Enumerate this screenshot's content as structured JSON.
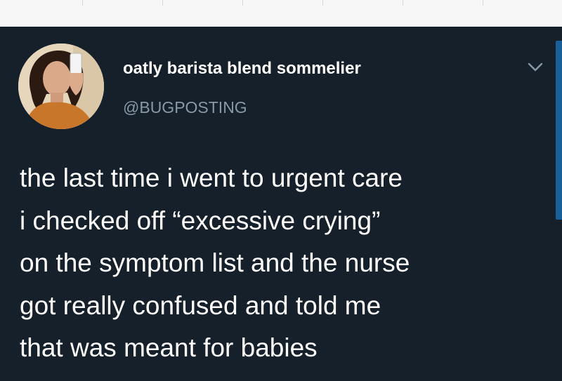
{
  "tweet": {
    "author": {
      "display_name": "oatly barista blend sommelier",
      "handle": "@BUGPOSTING",
      "avatar_icon": "profile-photo"
    },
    "menu_icon": "chevron-down-icon",
    "text_lines": [
      "the last time i went to urgent care",
      "i checked off “excessive crying”",
      "on the symptom list and the nurse",
      "got really confused and told me",
      "that was meant for babies"
    ]
  },
  "colors": {
    "card_background": "#15202b",
    "text_primary": "#ffffff",
    "text_secondary": "#8899a6",
    "scrollbar": "#1b5f9a"
  }
}
